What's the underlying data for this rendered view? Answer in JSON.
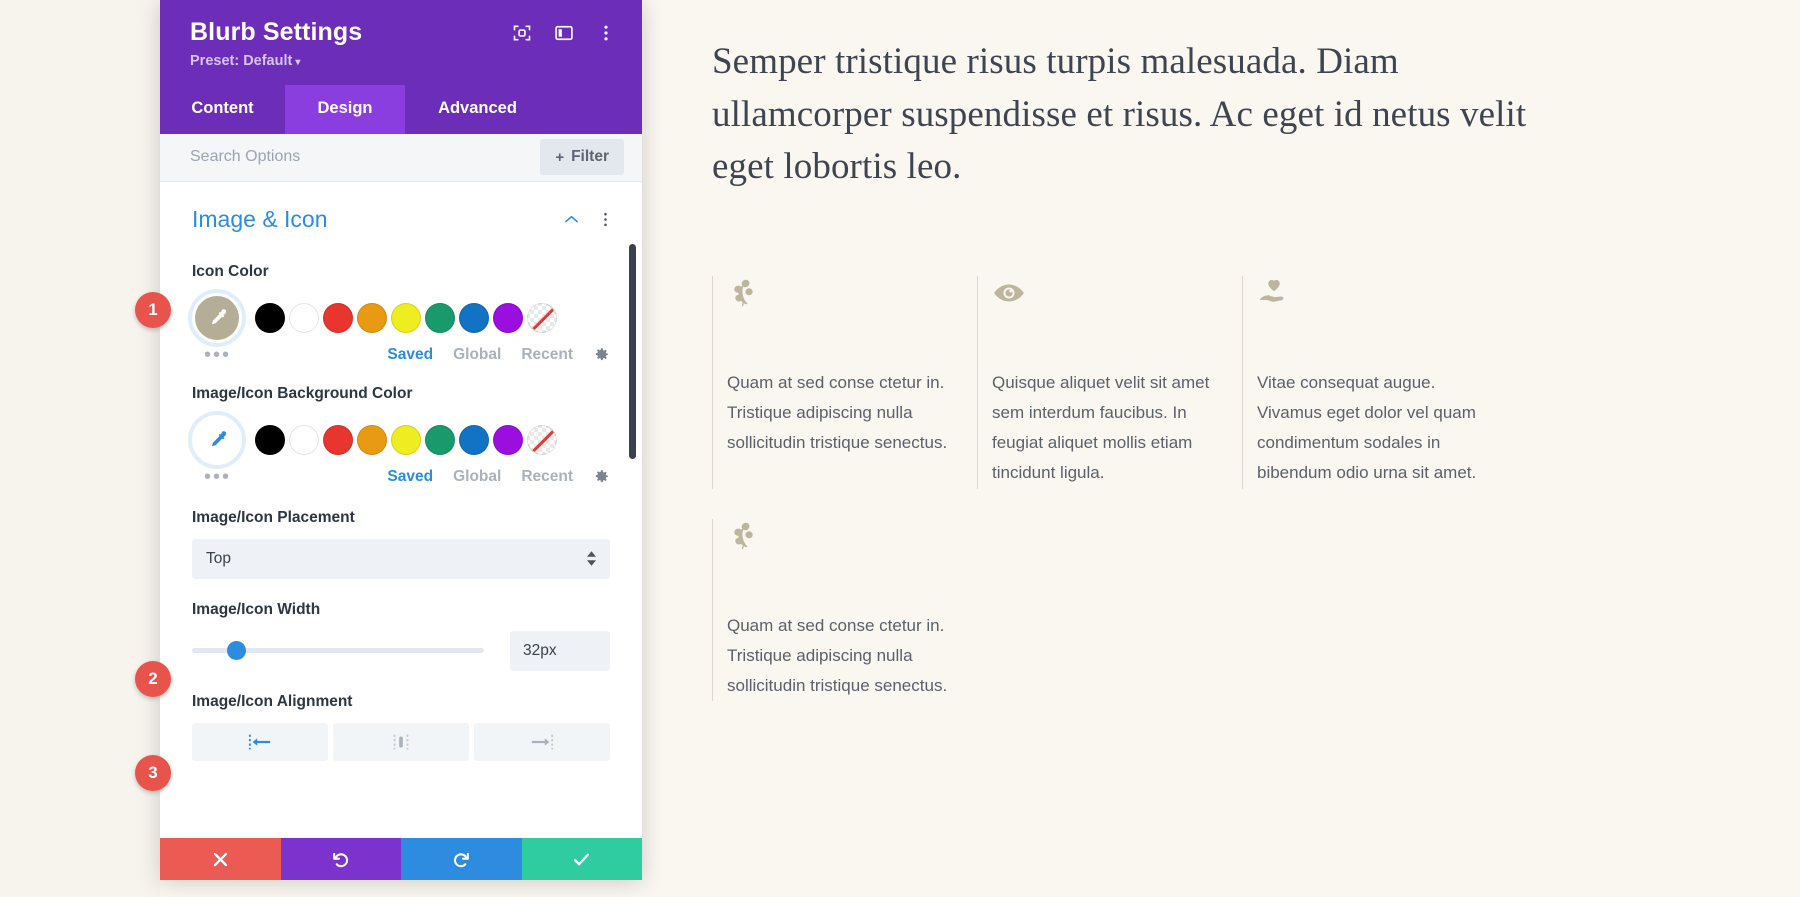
{
  "panel": {
    "title": "Blurb Settings",
    "preset": "Preset: Default",
    "preset_caret": "▾",
    "header_icons": [
      {
        "name": "focus-icon",
        "label": "Focus"
      },
      {
        "name": "layout-icon",
        "label": "Layout"
      },
      {
        "name": "more-vertical-icon",
        "label": "More"
      }
    ],
    "tabs": [
      {
        "label": "Content",
        "active": false
      },
      {
        "label": "Design",
        "active": true
      },
      {
        "label": "Advanced",
        "active": false
      }
    ],
    "search": {
      "placeholder": "Search Options",
      "value": ""
    },
    "filter_button": {
      "plus": "+",
      "label": "Filter"
    },
    "section": {
      "title": "Image & Icon",
      "collapse_label": "Collapse",
      "menu_label": "Section options"
    },
    "fields": {
      "icon_color": {
        "label": "Icon Color",
        "selected_color": "#b5ae96",
        "swatches": [
          "#000000",
          "#ffffff",
          "#e8352e",
          "#e89a13",
          "#eded1f",
          "#189a6d",
          "#1272c4",
          "#9a0ee0"
        ],
        "no_color_label": "No Color",
        "dots": "•••",
        "tabs": [
          {
            "label": "Saved",
            "active": true
          },
          {
            "label": "Global",
            "active": false
          },
          {
            "label": "Recent",
            "active": false
          }
        ],
        "gear_label": "Color settings"
      },
      "background_color": {
        "label": "Image/Icon Background Color",
        "selected_color": "#ffffff",
        "swatches": [
          "#000000",
          "#ffffff",
          "#e8352e",
          "#e89a13",
          "#eded1f",
          "#189a6d",
          "#1272c4",
          "#9a0ee0"
        ],
        "no_color_label": "No Color",
        "dots": "•••",
        "tabs": [
          {
            "label": "Saved",
            "active": true
          },
          {
            "label": "Global",
            "active": false
          },
          {
            "label": "Recent",
            "active": false
          }
        ],
        "gear_label": "Color settings"
      },
      "placement": {
        "label": "Image/Icon Placement",
        "value": "Top"
      },
      "width": {
        "label": "Image/Icon Width",
        "value": "32px",
        "slider_percent": 12
      },
      "alignment": {
        "label": "Image/Icon Alignment",
        "options": [
          {
            "name": "align-left",
            "active": true
          },
          {
            "name": "align-center",
            "active": false
          },
          {
            "name": "align-right",
            "active": false
          }
        ]
      }
    },
    "actions": [
      {
        "name": "close-button",
        "icon": "x",
        "color": "#eb5a53"
      },
      {
        "name": "undo-button",
        "icon": "undo",
        "color": "#7c32cc"
      },
      {
        "name": "redo-button",
        "icon": "redo",
        "color": "#2d8ce0"
      },
      {
        "name": "save-button",
        "icon": "check",
        "color": "#2ecca0"
      }
    ]
  },
  "badges": [
    {
      "number": "1",
      "target": "icon-color-picker"
    },
    {
      "number": "2",
      "target": "image-icon-width-slider"
    },
    {
      "number": "3",
      "target": "image-icon-alignment"
    }
  ],
  "content": {
    "lead_paragraph": "Semper tristique risus turpis malesuada. Diam ullamcorper suspendisse et risus. Ac eget id netus velit eget lobortis leo.",
    "blurbs": [
      {
        "icon": "leaf-icon",
        "text": "Quam at sed conse ctetur in. Tristique adipiscing nulla sollicitudin tristique senectus."
      },
      {
        "icon": "eye-icon",
        "text": "Quisque aliquet velit sit amet sem interdum faucibus. In feugiat aliquet mollis etiam tincidunt ligula."
      },
      {
        "icon": "hand-heart-icon",
        "text": "Vitae consequat augue. Vivamus eget dolor vel quam condimentum sodales in bibendum odio urna sit amet."
      },
      {
        "icon": "leaf-icon",
        "text": "Quam at sed conse ctetur in. Tristique adipiscing nulla sollicitudin tristique senectus."
      }
    ]
  },
  "colors": {
    "panel_header": "#6c2eb9",
    "tab_active": "#8b3ee0",
    "accent_blue": "#2d8ce0",
    "badge_red": "#e8544c",
    "page_bg": "#faf6f0",
    "blurb_icon": "#bdb69e"
  }
}
